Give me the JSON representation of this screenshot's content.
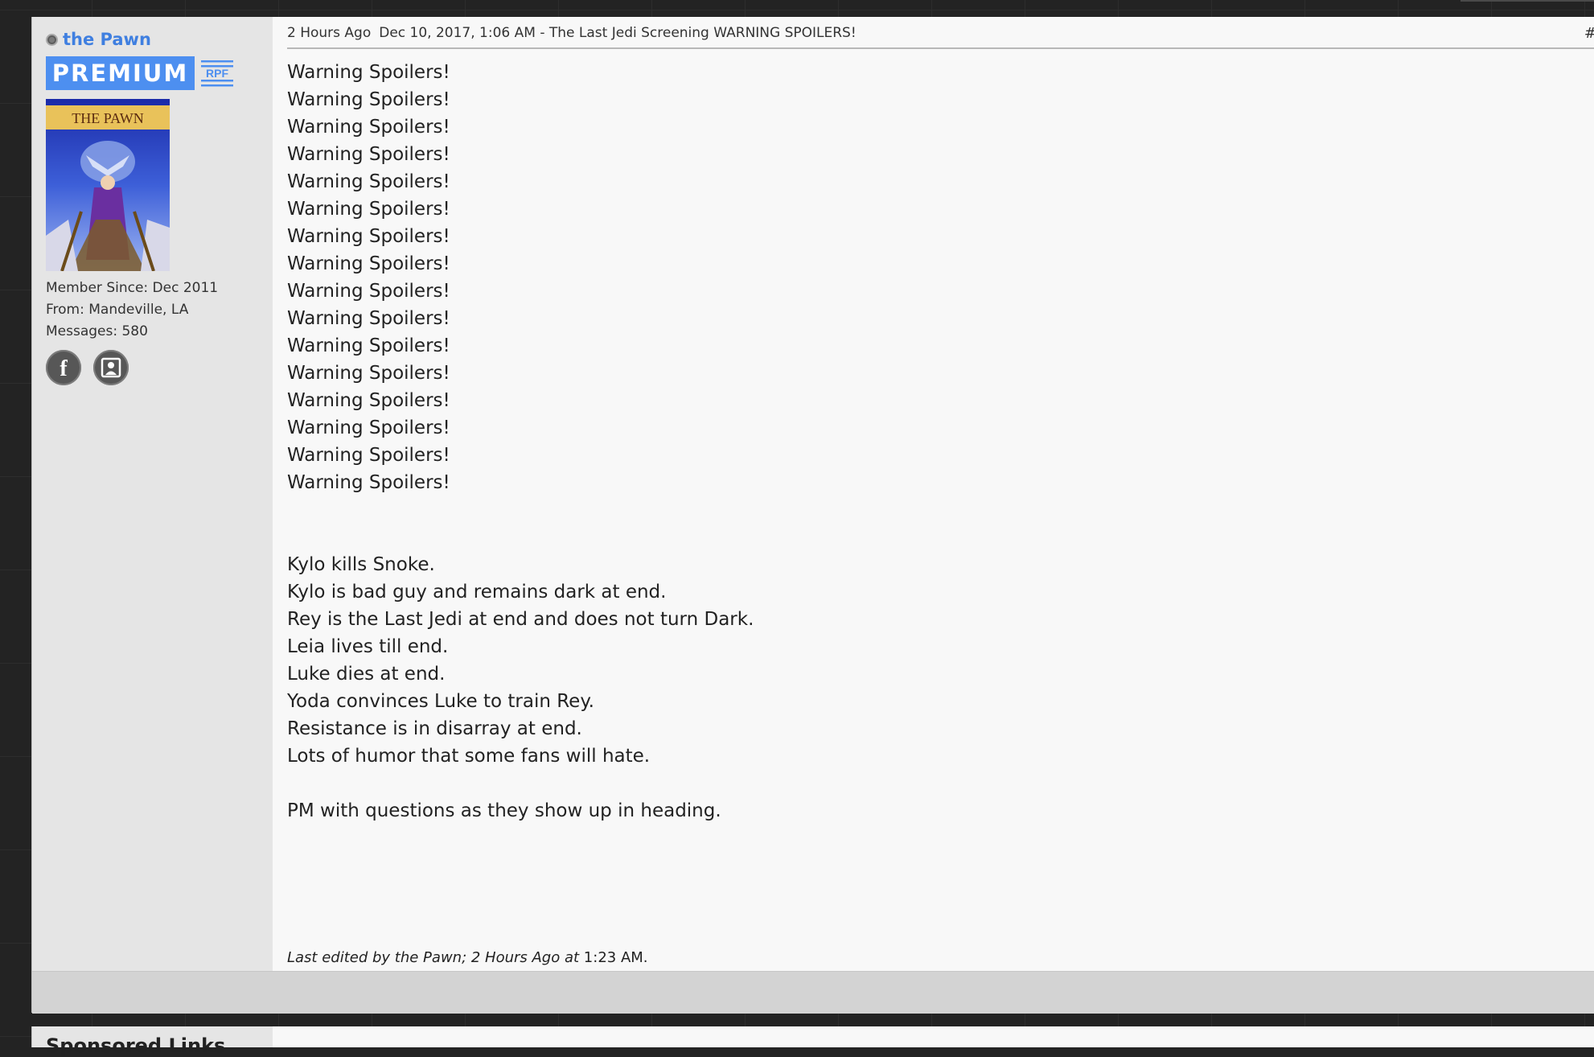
{
  "post": {
    "username": "the Pawn",
    "badge": "PREMIUM",
    "member_since": "Member Since: Dec 2011",
    "from": "From: Mandeville, LA",
    "messages": "Messages: 580",
    "header": {
      "relative_time": "2 Hours Ago",
      "title": "Dec 10, 2017, 1:06 AM - The Last Jedi Screening WARNING SPOILERS!",
      "post_number": "#"
    },
    "warning_lines": [
      "Warning Spoilers!",
      "Warning Spoilers!",
      "Warning Spoilers!",
      "Warning Spoilers!",
      "Warning Spoilers!",
      "Warning Spoilers!",
      "Warning Spoilers!",
      "Warning Spoilers!",
      "Warning Spoilers!",
      "Warning Spoilers!",
      "Warning Spoilers!",
      "Warning Spoilers!",
      "Warning Spoilers!",
      "Warning Spoilers!",
      "Warning Spoilers!",
      "Warning Spoilers!"
    ],
    "spoiler_lines": [
      "Kylo kills Snoke.",
      "Kylo is bad guy and remains dark at end.",
      "Rey is the Last Jedi at end and does not turn Dark.",
      "Leia lives till end.",
      "Luke dies at end.",
      "Yoda convinces Luke to train Rey.",
      "Resistance is in disarray at end.",
      "Lots of humor that some fans will hate."
    ],
    "closing_line": "PM with questions as they show up in heading.",
    "edit_note": {
      "italic": "Last edited by the Pawn; 2 Hours Ago at",
      "time": "1:23 AM."
    },
    "avatar_title": "THE PAWN"
  },
  "next_post": {
    "sponsored_label": "Sponsored Links"
  },
  "colors": {
    "accent": "#4d8ff0",
    "username": "#3f7fe0"
  }
}
